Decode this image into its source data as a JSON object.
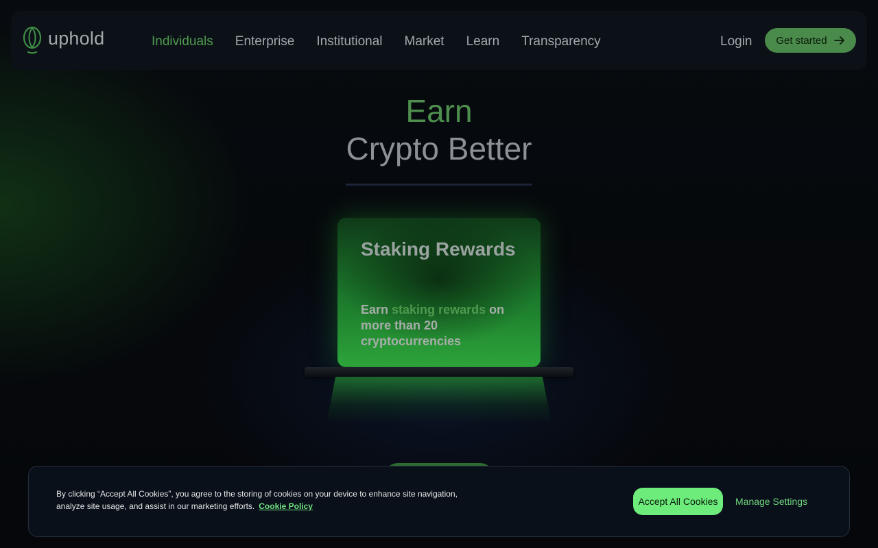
{
  "brand": {
    "name": "uphold",
    "logo_icon": "uphold-leaf-icon",
    "accent_color": "#4e9a4e"
  },
  "nav": {
    "items": [
      {
        "label": "Individuals",
        "active": true
      },
      {
        "label": "Enterprise",
        "active": false
      },
      {
        "label": "Institutional",
        "active": false
      },
      {
        "label": "Market",
        "active": false
      },
      {
        "label": "Learn",
        "active": false
      },
      {
        "label": "Transparency",
        "active": false
      }
    ],
    "login_label": "Login",
    "cta_label": "Get started",
    "cta_icon": "arrow-right-icon"
  },
  "hero": {
    "highlight": "Earn",
    "title": "Crypto Better"
  },
  "card": {
    "title": "Staking Rewards",
    "text_prefix": "Earn ",
    "text_highlight": "staking rewards",
    "text_suffix": " on more than 20 cryptocurrencies"
  },
  "cookie_banner": {
    "text": "By clicking “Accept All Cookies”, you agree to the storing of cookies on your device to enhance site navigation, analyze site usage, and assist in our marketing efforts.",
    "policy_link": "Cookie Policy",
    "accept_label": "Accept All Cookies",
    "manage_label": "Manage Settings",
    "accept_color": "#6dec7b"
  }
}
